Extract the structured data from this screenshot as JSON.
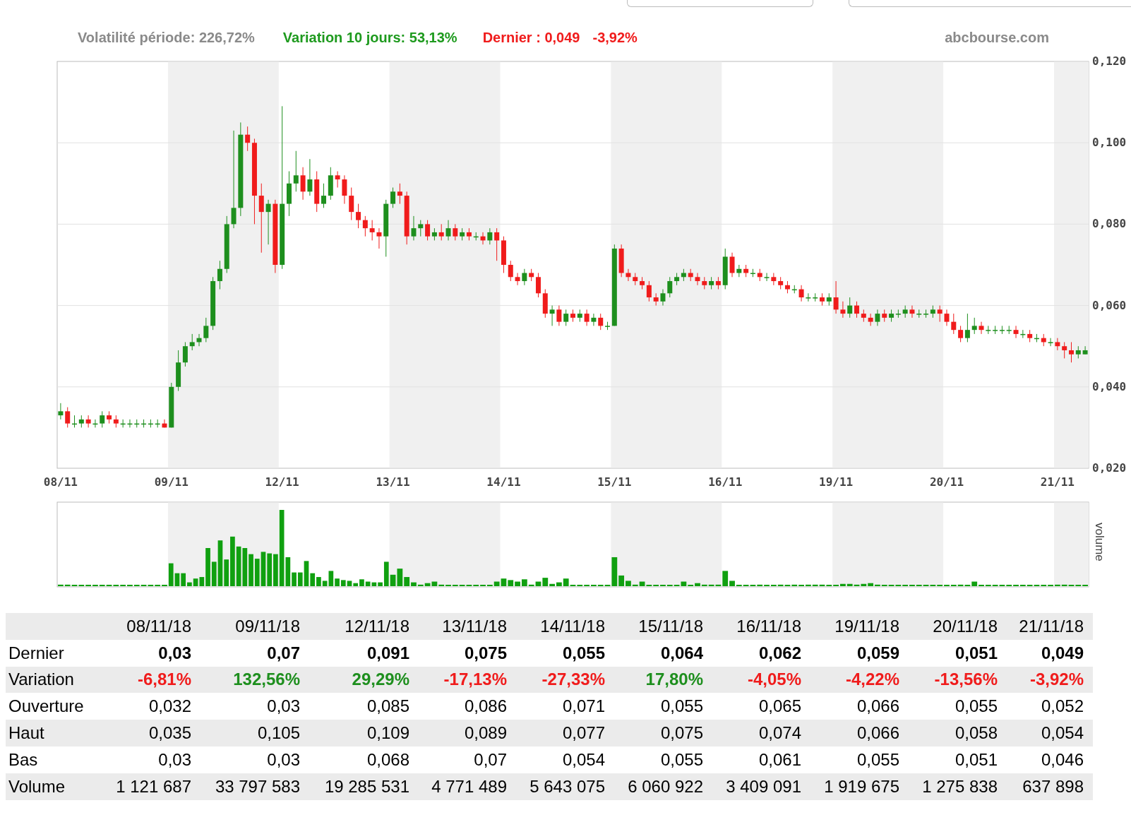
{
  "header_stats": [
    {
      "text": "Volatilité période: 226,72%",
      "color": "#8a8a8a"
    },
    {
      "text": "Variation 10 jours: 53,13%",
      "color": "#1e9a1e"
    },
    {
      "text": "Dernier : 0,049",
      "color": "#f01c1c"
    },
    {
      "text": "-3,92%",
      "color": "#f01c1c"
    }
  ],
  "site": "abcbourse.com",
  "price_chart": {
    "chart_data": {
      "type": "candlestick",
      "ylim": [
        0.02,
        0.12
      ],
      "grid": true,
      "categories": [
        "08/11",
        null,
        null,
        null,
        null,
        null,
        null,
        null,
        null,
        null,
        null,
        null,
        null,
        null,
        null,
        null,
        "09/11",
        null,
        null,
        null,
        null,
        null,
        null,
        null,
        null,
        null,
        null,
        null,
        null,
        null,
        null,
        null,
        "12/11",
        null,
        null,
        null,
        null,
        null,
        null,
        null,
        null,
        null,
        null,
        null,
        null,
        null,
        null,
        null,
        "13/11",
        null,
        null,
        null,
        null,
        null,
        null,
        null,
        null,
        null,
        null,
        null,
        null,
        null,
        null,
        null,
        "14/11",
        null,
        null,
        null,
        null,
        null,
        null,
        null,
        null,
        null,
        null,
        null,
        null,
        null,
        null,
        null,
        "15/11",
        null,
        null,
        null,
        null,
        null,
        null,
        null,
        null,
        null,
        null,
        null,
        null,
        null,
        null,
        null,
        "16/11",
        null,
        null,
        null,
        null,
        null,
        null,
        null,
        null,
        null,
        null,
        null,
        null,
        null,
        null,
        null,
        "19/11",
        null,
        null,
        null,
        null,
        null,
        null,
        null,
        null,
        null,
        null,
        null,
        null,
        null,
        null,
        null,
        "20/11",
        null,
        null,
        null,
        null,
        null,
        null,
        null,
        null,
        null,
        null,
        null,
        null,
        null,
        null,
        null,
        "21/11",
        null,
        null,
        null,
        null
      ],
      "yticks": [
        {
          "value": 0.12,
          "label": "0,120"
        },
        {
          "value": 0.1,
          "label": "0,100"
        },
        {
          "value": 0.08,
          "label": "0,080"
        },
        {
          "value": 0.06,
          "label": "0,060"
        },
        {
          "value": 0.04,
          "label": "0,040"
        },
        {
          "value": 0.02,
          "label": "0,020"
        }
      ],
      "ohlc": [
        [
          0.033,
          0.036,
          0.032,
          0.034
        ],
        [
          0.034,
          0.035,
          0.03,
          0.031
        ],
        [
          0.031,
          0.033,
          0.03,
          0.031
        ],
        [
          0.031,
          0.033,
          0.03,
          0.032
        ],
        [
          0.032,
          0.033,
          0.03,
          0.031
        ],
        [
          0.031,
          0.032,
          0.03,
          0.031
        ],
        [
          0.031,
          0.034,
          0.03,
          0.033
        ],
        [
          0.033,
          0.034,
          0.031,
          0.032
        ],
        [
          0.032,
          0.033,
          0.03,
          0.031
        ],
        [
          0.031,
          0.032,
          0.03,
          0.031
        ],
        [
          0.031,
          0.032,
          0.03,
          0.031
        ],
        [
          0.031,
          0.032,
          0.03,
          0.031
        ],
        [
          0.031,
          0.032,
          0.03,
          0.031
        ],
        [
          0.031,
          0.032,
          0.03,
          0.031
        ],
        [
          0.031,
          0.032,
          0.03,
          0.031
        ],
        [
          0.031,
          0.032,
          0.03,
          0.03
        ],
        [
          0.03,
          0.041,
          0.03,
          0.04
        ],
        [
          0.04,
          0.049,
          0.039,
          0.046
        ],
        [
          0.046,
          0.051,
          0.045,
          0.05
        ],
        [
          0.05,
          0.053,
          0.049,
          0.051
        ],
        [
          0.051,
          0.053,
          0.05,
          0.052
        ],
        [
          0.052,
          0.057,
          0.051,
          0.055
        ],
        [
          0.055,
          0.067,
          0.054,
          0.066
        ],
        [
          0.066,
          0.071,
          0.064,
          0.069
        ],
        [
          0.069,
          0.082,
          0.068,
          0.08
        ],
        [
          0.08,
          0.103,
          0.079,
          0.084
        ],
        [
          0.084,
          0.105,
          0.082,
          0.102
        ],
        [
          0.102,
          0.104,
          0.098,
          0.1
        ],
        [
          0.1,
          0.101,
          0.08,
          0.087
        ],
        [
          0.087,
          0.09,
          0.073,
          0.083
        ],
        [
          0.083,
          0.086,
          0.075,
          0.085
        ],
        [
          0.085,
          0.086,
          0.068,
          0.07
        ],
        [
          0.07,
          0.109,
          0.069,
          0.085
        ],
        [
          0.085,
          0.093,
          0.082,
          0.09
        ],
        [
          0.09,
          0.098,
          0.088,
          0.092
        ],
        [
          0.092,
          0.094,
          0.086,
          0.088
        ],
        [
          0.088,
          0.096,
          0.087,
          0.091
        ],
        [
          0.091,
          0.093,
          0.083,
          0.085
        ],
        [
          0.085,
          0.09,
          0.084,
          0.087
        ],
        [
          0.087,
          0.094,
          0.086,
          0.092
        ],
        [
          0.092,
          0.093,
          0.089,
          0.091
        ],
        [
          0.091,
          0.092,
          0.085,
          0.087
        ],
        [
          0.087,
          0.089,
          0.081,
          0.083
        ],
        [
          0.083,
          0.085,
          0.079,
          0.081
        ],
        [
          0.081,
          0.082,
          0.077,
          0.079
        ],
        [
          0.079,
          0.081,
          0.076,
          0.078
        ],
        [
          0.078,
          0.079,
          0.074,
          0.077
        ],
        [
          0.077,
          0.086,
          0.072,
          0.085
        ],
        [
          0.085,
          0.089,
          0.084,
          0.088
        ],
        [
          0.088,
          0.09,
          0.085,
          0.087
        ],
        [
          0.087,
          0.088,
          0.075,
          0.077
        ],
        [
          0.077,
          0.082,
          0.076,
          0.079
        ],
        [
          0.079,
          0.081,
          0.077,
          0.08
        ],
        [
          0.08,
          0.081,
          0.076,
          0.077
        ],
        [
          0.077,
          0.079,
          0.076,
          0.078
        ],
        [
          0.078,
          0.08,
          0.076,
          0.077
        ],
        [
          0.077,
          0.081,
          0.076,
          0.079
        ],
        [
          0.079,
          0.08,
          0.076,
          0.077
        ],
        [
          0.077,
          0.079,
          0.076,
          0.078
        ],
        [
          0.078,
          0.079,
          0.076,
          0.077
        ],
        [
          0.077,
          0.078,
          0.076,
          0.077
        ],
        [
          0.077,
          0.078,
          0.075,
          0.076
        ],
        [
          0.076,
          0.079,
          0.075,
          0.078
        ],
        [
          0.078,
          0.079,
          0.071,
          0.076
        ],
        [
          0.076,
          0.077,
          0.068,
          0.07
        ],
        [
          0.07,
          0.071,
          0.066,
          0.067
        ],
        [
          0.067,
          0.068,
          0.065,
          0.066
        ],
        [
          0.066,
          0.069,
          0.065,
          0.068
        ],
        [
          0.068,
          0.069,
          0.066,
          0.067
        ],
        [
          0.067,
          0.068,
          0.062,
          0.063
        ],
        [
          0.063,
          0.064,
          0.057,
          0.058
        ],
        [
          0.058,
          0.06,
          0.055,
          0.059
        ],
        [
          0.059,
          0.06,
          0.055,
          0.056
        ],
        [
          0.056,
          0.059,
          0.055,
          0.058
        ],
        [
          0.058,
          0.059,
          0.056,
          0.057
        ],
        [
          0.057,
          0.059,
          0.056,
          0.058
        ],
        [
          0.058,
          0.059,
          0.055,
          0.056
        ],
        [
          0.056,
          0.058,
          0.055,
          0.057
        ],
        [
          0.057,
          0.058,
          0.054,
          0.055
        ],
        [
          0.055,
          0.056,
          0.054,
          0.055
        ],
        [
          0.055,
          0.075,
          0.055,
          0.074
        ],
        [
          0.074,
          0.075,
          0.067,
          0.068
        ],
        [
          0.068,
          0.069,
          0.066,
          0.067
        ],
        [
          0.067,
          0.068,
          0.065,
          0.066
        ],
        [
          0.066,
          0.067,
          0.064,
          0.065
        ],
        [
          0.065,
          0.066,
          0.061,
          0.062
        ],
        [
          0.062,
          0.063,
          0.06,
          0.061
        ],
        [
          0.061,
          0.064,
          0.06,
          0.063
        ],
        [
          0.063,
          0.067,
          0.062,
          0.066
        ],
        [
          0.066,
          0.068,
          0.065,
          0.067
        ],
        [
          0.067,
          0.069,
          0.066,
          0.068
        ],
        [
          0.068,
          0.069,
          0.066,
          0.067
        ],
        [
          0.067,
          0.068,
          0.065,
          0.066
        ],
        [
          0.066,
          0.067,
          0.064,
          0.065
        ],
        [
          0.065,
          0.067,
          0.064,
          0.066
        ],
        [
          0.066,
          0.067,
          0.064,
          0.065
        ],
        [
          0.065,
          0.074,
          0.064,
          0.072
        ],
        [
          0.072,
          0.073,
          0.067,
          0.068
        ],
        [
          0.068,
          0.07,
          0.067,
          0.069
        ],
        [
          0.069,
          0.07,
          0.067,
          0.068
        ],
        [
          0.068,
          0.069,
          0.067,
          0.068
        ],
        [
          0.068,
          0.069,
          0.066,
          0.067
        ],
        [
          0.067,
          0.068,
          0.066,
          0.067
        ],
        [
          0.067,
          0.068,
          0.065,
          0.066
        ],
        [
          0.066,
          0.067,
          0.064,
          0.065
        ],
        [
          0.065,
          0.066,
          0.063,
          0.064
        ],
        [
          0.064,
          0.065,
          0.063,
          0.064
        ],
        [
          0.064,
          0.065,
          0.061,
          0.062
        ],
        [
          0.062,
          0.063,
          0.061,
          0.062
        ],
        [
          0.062,
          0.063,
          0.061,
          0.062
        ],
        [
          0.062,
          0.063,
          0.06,
          0.061
        ],
        [
          0.061,
          0.063,
          0.06,
          0.062
        ],
        [
          0.062,
          0.066,
          0.058,
          0.059
        ],
        [
          0.059,
          0.061,
          0.057,
          0.058
        ],
        [
          0.058,
          0.062,
          0.057,
          0.06
        ],
        [
          0.06,
          0.061,
          0.057,
          0.058
        ],
        [
          0.058,
          0.059,
          0.056,
          0.057
        ],
        [
          0.057,
          0.058,
          0.055,
          0.056
        ],
        [
          0.056,
          0.059,
          0.055,
          0.058
        ],
        [
          0.058,
          0.059,
          0.056,
          0.057
        ],
        [
          0.057,
          0.059,
          0.056,
          0.058
        ],
        [
          0.058,
          0.059,
          0.057,
          0.058
        ],
        [
          0.058,
          0.06,
          0.057,
          0.059
        ],
        [
          0.059,
          0.06,
          0.057,
          0.058
        ],
        [
          0.058,
          0.059,
          0.057,
          0.058
        ],
        [
          0.058,
          0.059,
          0.057,
          0.058
        ],
        [
          0.058,
          0.06,
          0.057,
          0.059
        ],
        [
          0.059,
          0.06,
          0.056,
          0.058
        ],
        [
          0.058,
          0.059,
          0.055,
          0.056
        ],
        [
          0.056,
          0.058,
          0.053,
          0.054
        ],
        [
          0.054,
          0.055,
          0.051,
          0.052
        ],
        [
          0.052,
          0.058,
          0.051,
          0.054
        ],
        [
          0.054,
          0.057,
          0.053,
          0.055
        ],
        [
          0.055,
          0.056,
          0.053,
          0.054
        ],
        [
          0.054,
          0.055,
          0.053,
          0.054
        ],
        [
          0.054,
          0.055,
          0.053,
          0.054
        ],
        [
          0.054,
          0.055,
          0.053,
          0.054
        ],
        [
          0.054,
          0.055,
          0.053,
          0.054
        ],
        [
          0.054,
          0.055,
          0.052,
          0.053
        ],
        [
          0.053,
          0.054,
          0.052,
          0.053
        ],
        [
          0.053,
          0.054,
          0.051,
          0.052
        ],
        [
          0.052,
          0.053,
          0.051,
          0.052
        ],
        [
          0.052,
          0.053,
          0.05,
          0.051
        ],
        [
          0.051,
          0.052,
          0.05,
          0.051
        ],
        [
          0.051,
          0.052,
          0.049,
          0.05
        ],
        [
          0.05,
          0.051,
          0.047,
          0.049
        ],
        [
          0.049,
          0.051,
          0.046,
          0.048
        ],
        [
          0.048,
          0.05,
          0.047,
          0.049
        ],
        [
          0.048,
          0.05,
          0.048,
          0.049
        ]
      ]
    }
  },
  "volume_panel": {
    "label": "volume"
  },
  "table": {
    "columns": [
      "08/11/18",
      "09/11/18",
      "12/11/18",
      "13/11/18",
      "14/11/18",
      "15/11/18",
      "16/11/18",
      "19/11/18",
      "20/11/18",
      "21/11/18"
    ],
    "rows": [
      {
        "label": "Dernier",
        "kind": "bold",
        "cells": [
          "0,03",
          "0,07",
          "0,091",
          "0,075",
          "0,055",
          "0,064",
          "0,062",
          "0,059",
          "0,051",
          "0,049"
        ]
      },
      {
        "label": "Variation",
        "kind": "variation",
        "cells": [
          {
            "text": "-6,81%",
            "color": "#f01c1c"
          },
          {
            "text": "132,56%",
            "color": "#1e8f1e"
          },
          {
            "text": "29,29%",
            "color": "#1e8f1e"
          },
          {
            "text": "-17,13%",
            "color": "#f01c1c"
          },
          {
            "text": "-27,33%",
            "color": "#f01c1c"
          },
          {
            "text": "17,80%",
            "color": "#1e8f1e"
          },
          {
            "text": "-4,05%",
            "color": "#f01c1c"
          },
          {
            "text": "-4,22%",
            "color": "#f01c1c"
          },
          {
            "text": "-13,56%",
            "color": "#f01c1c"
          },
          {
            "text": "-3,92%",
            "color": "#f01c1c"
          }
        ]
      },
      {
        "label": "Ouverture",
        "kind": "plain",
        "cells": [
          "0,032",
          "0,03",
          "0,085",
          "0,086",
          "0,071",
          "0,055",
          "0,065",
          "0,066",
          "0,055",
          "0,052"
        ]
      },
      {
        "label": "Haut",
        "kind": "plain",
        "cells": [
          "0,035",
          "0,105",
          "0,109",
          "0,089",
          "0,077",
          "0,075",
          "0,074",
          "0,066",
          "0,058",
          "0,054"
        ]
      },
      {
        "label": "Bas",
        "kind": "plain",
        "cells": [
          "0,03",
          "0,03",
          "0,068",
          "0,07",
          "0,054",
          "0,055",
          "0,061",
          "0,055",
          "0,051",
          "0,046"
        ]
      },
      {
        "label": "Volume",
        "kind": "plain",
        "cells": [
          "1 121 687",
          "33 797 583",
          "19 285 531",
          "4 771 489",
          "5 643 075",
          "6 060 922",
          "3 409 091",
          "1 919 675",
          "1 275 838",
          "637 898"
        ]
      }
    ]
  }
}
